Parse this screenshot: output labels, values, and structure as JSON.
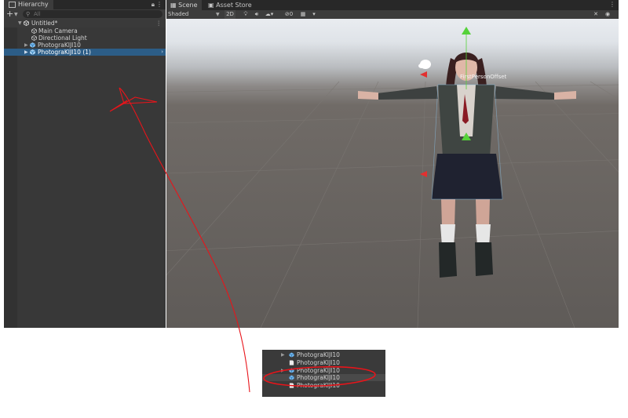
{
  "hierarchy": {
    "tab_label": "Hierarchy",
    "lock_icon": "lock-icon",
    "add_label": "+",
    "search_placeholder": "All",
    "scene_name": "Untitled*",
    "items": [
      {
        "label": "Main Camera",
        "icon": "gameobject-icon"
      },
      {
        "label": "Directional Light",
        "icon": "gameobject-icon"
      },
      {
        "label": "PhotograKIJI10",
        "icon": "prefab-icon",
        "expandable": true
      },
      {
        "label": "PhotograKIJI10 (1)",
        "icon": "prefab-icon",
        "expandable": true,
        "selected": true
      }
    ]
  },
  "scene": {
    "tabs": [
      {
        "label": "Scene",
        "active": true
      },
      {
        "label": "Asset Store",
        "active": false
      }
    ],
    "toolbar": {
      "shading": "Shaded",
      "toggle_2d": "2D",
      "visibility_count": "0"
    },
    "object_label": "FirstPersonOffset"
  },
  "inset": {
    "rows": [
      {
        "label": "PhotograKIJI10",
        "icon": "prefab-icon",
        "expandable": true
      },
      {
        "label": "PhotograKIJI10",
        "icon": "file-icon"
      },
      {
        "label": "PhotograKIJI10",
        "icon": "prefab-icon",
        "expandable": true
      },
      {
        "label": "PhotograKIJI10",
        "icon": "prefab-icon",
        "highlighted": true
      },
      {
        "label": "PhotograKIJI10",
        "icon": "file-icon"
      }
    ]
  },
  "colors": {
    "panel_bg": "#383838",
    "toolbar_bg": "#3c3c3c",
    "selection": "#2c5d87",
    "prefab_blue": "#6fb6f0",
    "annotation_red": "#e8141a"
  }
}
